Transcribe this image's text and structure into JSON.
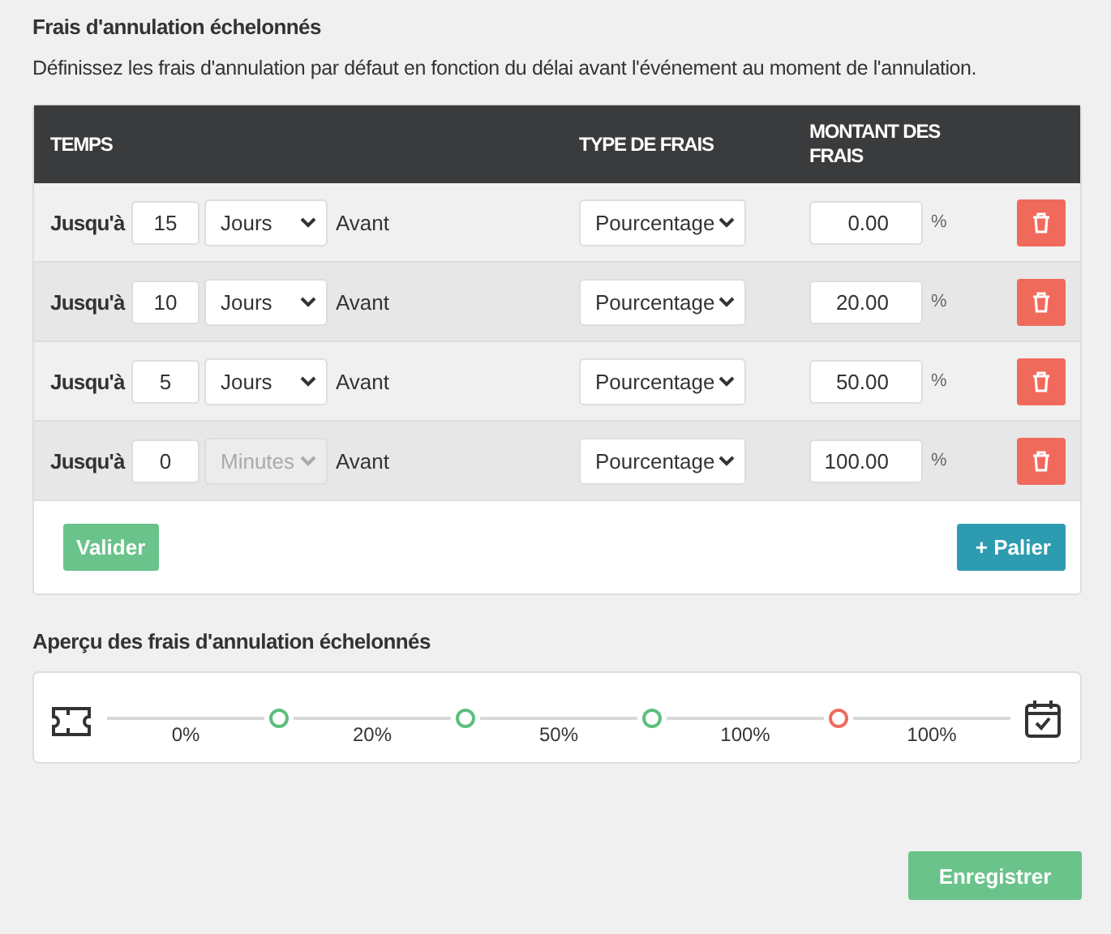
{
  "title": "Frais d'annulation échelonnés",
  "description": "Définissez les frais d'annulation par défaut en fonction du délai avant l'événement au moment de l'annulation.",
  "table": {
    "columns": [
      "TEMPS",
      "TYPE DE FRAIS",
      "MONTANT DES FRAIS"
    ],
    "rows": [
      {
        "prefix": "Jusqu'à",
        "value": "15",
        "unit": "Jours",
        "unit_disabled": false,
        "suffix": "Avant",
        "fee_type": "Pourcentage",
        "amount": "0.00",
        "unit_sign": "%"
      },
      {
        "prefix": "Jusqu'à",
        "value": "10",
        "unit": "Jours",
        "unit_disabled": false,
        "suffix": "Avant",
        "fee_type": "Pourcentage",
        "amount": "20.00",
        "unit_sign": "%"
      },
      {
        "prefix": "Jusqu'à",
        "value": "5",
        "unit": "Jours",
        "unit_disabled": false,
        "suffix": "Avant",
        "fee_type": "Pourcentage",
        "amount": "50.00",
        "unit_sign": "%"
      },
      {
        "prefix": "Jusqu'à",
        "value": "0",
        "unit": "Minutes",
        "unit_disabled": true,
        "suffix": "Avant",
        "fee_type": "Pourcentage",
        "amount": "100.00",
        "unit_sign": "%"
      }
    ]
  },
  "validate_button": "Valider",
  "add_button": "+ Palier",
  "preview": {
    "title": "Aperçu des frais d'annulation échelonnés",
    "segments": [
      {
        "label": "0%"
      },
      {
        "label": "20%"
      },
      {
        "label": "50%"
      },
      {
        "label": "100%"
      },
      {
        "label": "100%"
      }
    ],
    "dots": [
      {
        "color": "#5cbf7e"
      },
      {
        "color": "#5cbf7e"
      },
      {
        "color": "#5cbf7e"
      },
      {
        "color": "#ef6a5c"
      }
    ]
  },
  "save_button": "Enregistrer"
}
